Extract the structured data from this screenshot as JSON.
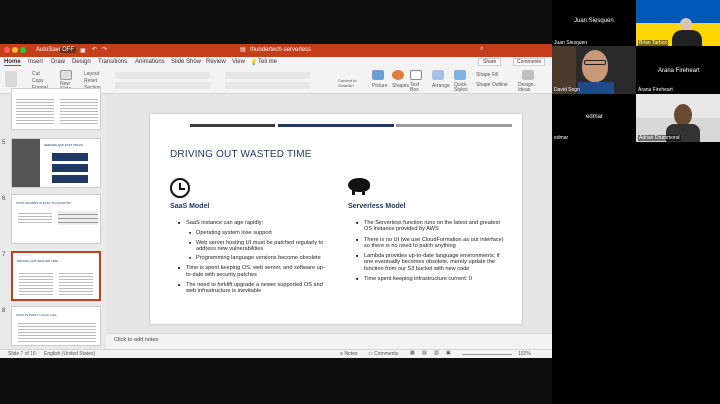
{
  "ppt": {
    "autosave_label": "AutoSave",
    "autosave_state": "OFF",
    "doc_title": "thundertech-serverless",
    "search_placeholder": "Tell me",
    "tabs": [
      "Home",
      "Insert",
      "Draw",
      "Design",
      "Transitions",
      "Animations",
      "Slide Show",
      "Review",
      "View"
    ],
    "share_label": "Share",
    "comments_label": "Comments",
    "ribbon": {
      "cut": "Cut",
      "copy": "Copy",
      "format": "Format",
      "paste": "Paste",
      "new_slide": "New Slide",
      "layout": "Layout",
      "reset": "Reset",
      "section": "Section",
      "convert": "Convert to SmartArt",
      "picture": "Picture",
      "shapes": "Shapes",
      "textbox": "Text Box",
      "arrange": "Arrange",
      "quick_styles": "Quick Styles",
      "shape_fill": "Shape Fill",
      "shape_outline": "Shape Outline",
      "design_ideas": "Design Ideas"
    },
    "thumbs": [
      {
        "num": "",
        "title": ""
      },
      {
        "num": "5",
        "title": "SERVERLESS FAST TRACK"
      },
      {
        "num": "6",
        "title": "COST SAVINGS IS EASY TO QUANTIFY"
      },
      {
        "num": "7",
        "title": "DRIVING OUT WASTED TIME"
      },
      {
        "num": "8",
        "title": "LOCK-IN POINT: LOCAL LOG"
      }
    ],
    "slide": {
      "title": "DRIVING OUT WASTED TIME",
      "left": {
        "heading": "SaaS Model",
        "bullets": [
          {
            "level": 1,
            "text": "SaaS instance can age rapidly:"
          },
          {
            "level": 2,
            "text": "Operating system lose support"
          },
          {
            "level": 2,
            "text": "Web server hosting UI must be patched regularly to address new vulnerabilities"
          },
          {
            "level": 2,
            "text": "Programming language versions become obsolete"
          },
          {
            "level": 1,
            "text": "Time is spent keeping OS, web server, and software up-to-date with security patches"
          },
          {
            "level": 1,
            "text": "The need to forklift upgrade a newer supported OS and web infrastructure is inevitable"
          }
        ]
      },
      "right": {
        "heading": "Serverless Model",
        "bullets": [
          {
            "level": 1,
            "text": "The Serverless function runs on the latest and greatest OS instance provided by AWS"
          },
          {
            "level": 1,
            "text": "There is no UI (we use CloudFormation as our interface) so there is no need to patch anything"
          },
          {
            "level": 1,
            "text": "Lambda provides up-to-date language environments; if one eventually becomes obsolete, merely update the function from our S3 bucket with new code"
          },
          {
            "level": 1,
            "text": "Time spent keeping infrastructure current: 0"
          }
        ]
      }
    },
    "notes_placeholder": "Click to add notes",
    "status": {
      "slide_count": "Slide 7 of 16",
      "language": "English (United States)",
      "notes": "Notes",
      "comments": "Comments",
      "zoom": "102%"
    }
  },
  "video": {
    "active_speaker": "Juan Siesquen",
    "tiles": [
      {
        "name": "Juan Siesquen"
      },
      {
        "name": "Brian Tarbox"
      },
      {
        "name": "David Sogn"
      },
      {
        "name": "Arana Fireheart"
      },
      {
        "name": "edmar"
      },
      {
        "name": "Adrian Drummond"
      }
    ],
    "tile_labels": {
      "arana_big": "Arana Fireheart",
      "edmar_big": "edmar"
    }
  },
  "colors": {
    "ppt_accent": "#c43e1c",
    "slide_title": "#1f3864",
    "bar_dark": "#3a3a3a",
    "bar_blue": "#1f3864",
    "bar_gray": "#9b9b9b",
    "ukraine_blue": "#0057b7",
    "ukraine_yellow": "#ffd700"
  }
}
